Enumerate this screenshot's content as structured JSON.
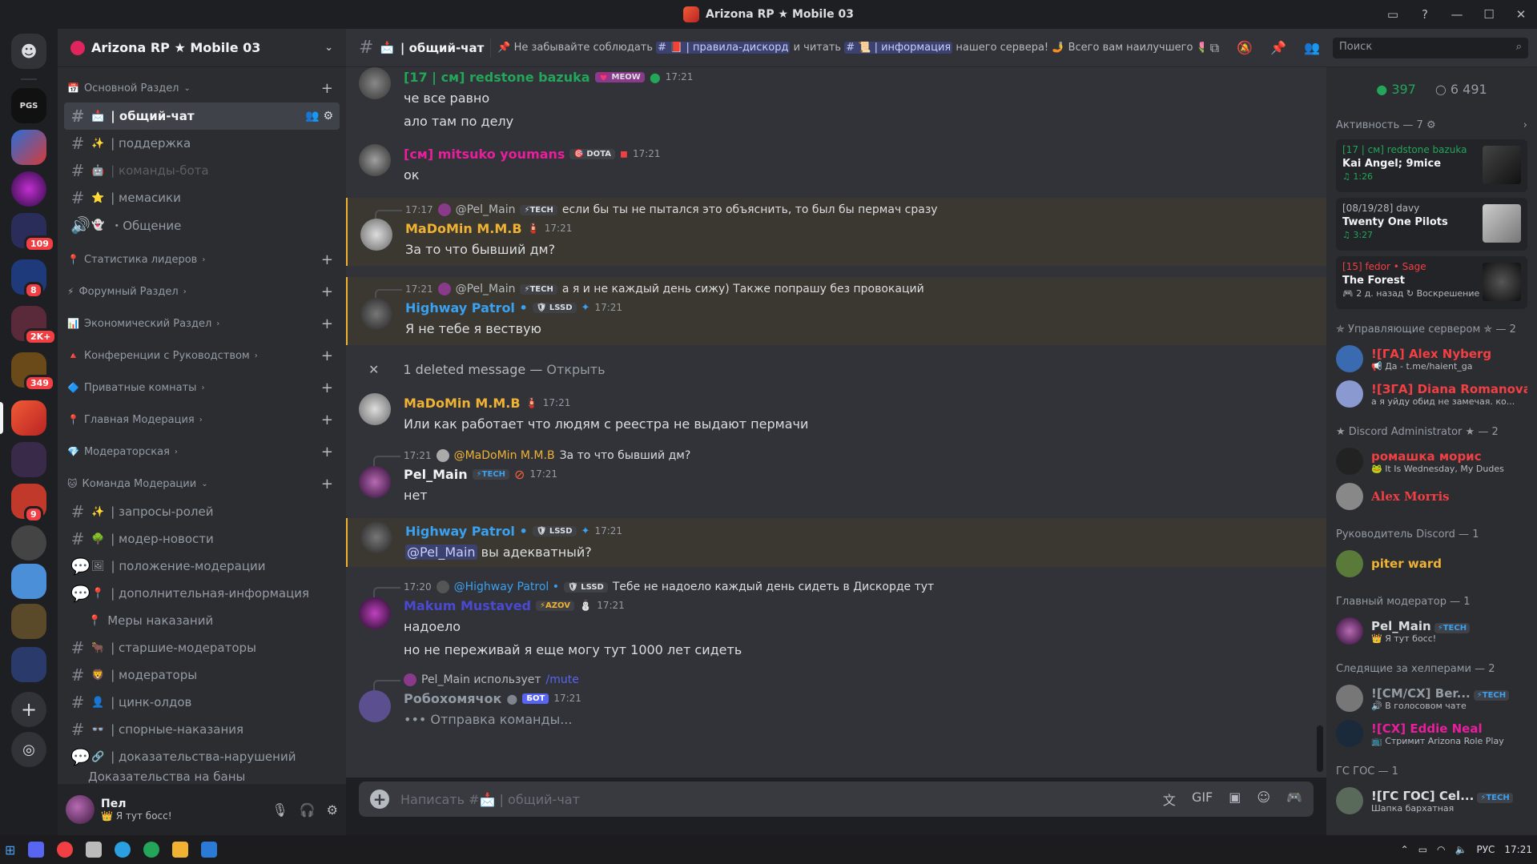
{
  "window": {
    "title": "Arizona RP ★ Mobile 03",
    "controls": [
      "▭",
      "?",
      "—",
      "☐",
      "✕"
    ]
  },
  "server": {
    "name": "Arizona RP ★ Mobile 03"
  },
  "rail": {
    "badges": [
      "109",
      "8",
      "2K+",
      "349",
      "9"
    ],
    "labels": {
      "pgs": "PGS"
    }
  },
  "sidebar": {
    "categories": {
      "main": "Основной Раздел",
      "stats": "Статистика лидеров",
      "forum": "Форумный Раздел",
      "econ": "Экономический Раздел",
      "conf": "Конференции с Руководством",
      "private": "Приватные комнаты",
      "moder": "Главная Модерация",
      "modroom": "Модераторская",
      "team": "Команда Модерации"
    },
    "channels": {
      "general": "| общий-чат",
      "support": "| поддержка",
      "bots": "| команды-бота",
      "memes": "| мемасики",
      "voice": "・Общение",
      "roles": "| запросы-ролей",
      "modnews": "| модер-новости",
      "modpos": "| положение-модерации",
      "addinfo": "| дополнительная-информация",
      "punish": "Меры наказаний",
      "senior": "| старшие-модераторы",
      "mods": "| модераторы",
      "zinc": "| цинк-олдов",
      "disputed": "| спорные-наказания",
      "evidence": "| доказательства-нарушений",
      "thread": "Доказательства на баны [обязательно ‼️]."
    }
  },
  "user": {
    "name": "Пел",
    "status": "👑 Я тут босс!"
  },
  "chat": {
    "channel": "| общий-чат",
    "topic_a": "📌 Не забывайте соблюдать",
    "topic_m1": "# 📕 | правила-дискорд",
    "topic_b": "и читать",
    "topic_m2": "# 📜 | информация",
    "topic_c": "нашего сервера! 🤳 Всего вам наилучшего 🌷",
    "composer_placeholder": "Написать #📩 | общий-чат"
  },
  "search": {
    "placeholder": "Поиск"
  },
  "messages": [
    {
      "user": "[17 | см] redstone bazuka",
      "tag": "💗 MEOW",
      "time": "17:21",
      "lines": [
        "че все равно",
        "ало там по делу"
      ]
    },
    {
      "user": "[см] mitsuko youmans",
      "tag": "🎯 DOTA",
      "time": "17:21",
      "lines": [
        "ок"
      ]
    },
    {
      "reply_time": "17:17",
      "reply_user": "@Pel_Main",
      "reply_tag": "⚡TECH",
      "reply_text": "если бы ты не пытался это объяснить, то был бы пермач сразу",
      "user": "MaDoMin M.M.B",
      "time": "17:21",
      "lines": [
        "За то что бывший дм?"
      ]
    },
    {
      "reply_time": "17:21",
      "reply_user": "@Pel_Main",
      "reply_tag": "⚡TECH",
      "reply_text": "а я и не каждый день сижу) Также попрашу без провокаций",
      "user": "Highway Patrol •",
      "tag": "🛡 LSSD",
      "time": "17:21",
      "lines": [
        "Я не тебе я вествую"
      ]
    },
    {
      "deleted": "1 deleted message —",
      "open": "Открыть"
    },
    {
      "user": "MaDoMin M.M.B",
      "time": "17:21",
      "lines": [
        "Или как работает что людям с реестра не выдают пермачи"
      ]
    },
    {
      "reply_time": "17:21",
      "reply_user": "@MaDoMin M.M.B",
      "reply_text": "За то что бывший дм?",
      "user": "Pel_Main",
      "tag": "⚡TECH",
      "time": "17:21",
      "lines": [
        "нет"
      ]
    },
    {
      "user": "Highway Patrol •",
      "tag": "🛡 LSSD",
      "time": "17:21",
      "mention": "@Pel_Main",
      "lines": [
        "вы адекватный?"
      ]
    },
    {
      "reply_time": "17:20",
      "reply_user": "@Highway Patrol •",
      "reply_tag": "🛡 LSSD",
      "reply_text": "Тебе не надоело каждый день сидеть в Дискорде тут",
      "user": "Makum Mustaved",
      "tag": "⚡AZOV",
      "time": "17:21",
      "lines": [
        "надоело",
        "но не переживай я еще могу тут 1000 лет сидеть"
      ]
    },
    {
      "reply_user": "Pel_Main использует",
      "reply_cmd": "/mute",
      "user": "Робохомячок",
      "bot": "БОТ",
      "time": "17:21",
      "lines": [
        "Отправка команды..."
      ]
    }
  ],
  "members": {
    "online": "397",
    "total": "6 491",
    "activity_header": "Активность — 7",
    "activities": [
      {
        "user": "[17 | см] redstone bazuka",
        "title": "Kai Angel; 9mice",
        "detail": "♫ 1:26"
      },
      {
        "user": "[08/19/28] davy",
        "title": "Twenty One Pilots",
        "detail": "♫ 3:27"
      },
      {
        "user": "[15] fedor • Sage",
        "title": "The Forest",
        "detail": "🎮 2 д. назад  ↻ Воскрешение"
      }
    ],
    "groups": [
      {
        "title": "✯ Управляющие сервером ✯ — 2",
        "items": [
          {
            "name": "![ГА] Alex Nyberg",
            "status": "📢 Да - t.me/haient_ga",
            "color": "#f23f43"
          },
          {
            "name": "![ЗГА] Diana Romanova",
            "status": "а я уйду обид не замечая. ко...",
            "color": "#f23f43"
          }
        ]
      },
      {
        "title": "★ Discord Administrator ★ — 2",
        "items": [
          {
            "name": "ромашка морис",
            "status": "🐸 It Is Wednesday, My Dudes",
            "color": "#f23f43"
          },
          {
            "name": "Alex Morris",
            "status": "",
            "color": "#f23f43"
          }
        ]
      },
      {
        "title": "Руководитель Discord — 1",
        "items": [
          {
            "name": "piter ward",
            "status": "",
            "color": "#f0b232"
          }
        ]
      },
      {
        "title": "Главный модератор — 1",
        "items": [
          {
            "name": "Pel_Main",
            "tag": "⚡TECH",
            "status": "👑 Я тут босс!",
            "color": "#f2f3f5"
          }
        ]
      },
      {
        "title": "Следящие за хелперами — 2",
        "items": [
          {
            "name": "![СМ/СХ] Ber...",
            "tag": "⚡TECH",
            "status": "🔊 В голосовом чате",
            "color": "#949ba4"
          },
          {
            "name": "![СХ] Eddie Neal",
            "status": "📺 Стримит Arizona Role Play",
            "color": "#f23f43"
          }
        ]
      },
      {
        "title": "ГС ГОС — 1",
        "items": [
          {
            "name": "![ГС ГОС] Cel...",
            "tag": "⚡TECH",
            "status": "Шапка бархатная",
            "color": "#f2f3f5"
          }
        ]
      }
    ]
  },
  "taskbar": {
    "lang": "РУС",
    "time": "17:21"
  },
  "colors": {
    "orange": "#f0b232",
    "blue": "#3aa0f0",
    "green": "#23a55a",
    "pink": "#e91e9c",
    "red": "#f23f43"
  }
}
